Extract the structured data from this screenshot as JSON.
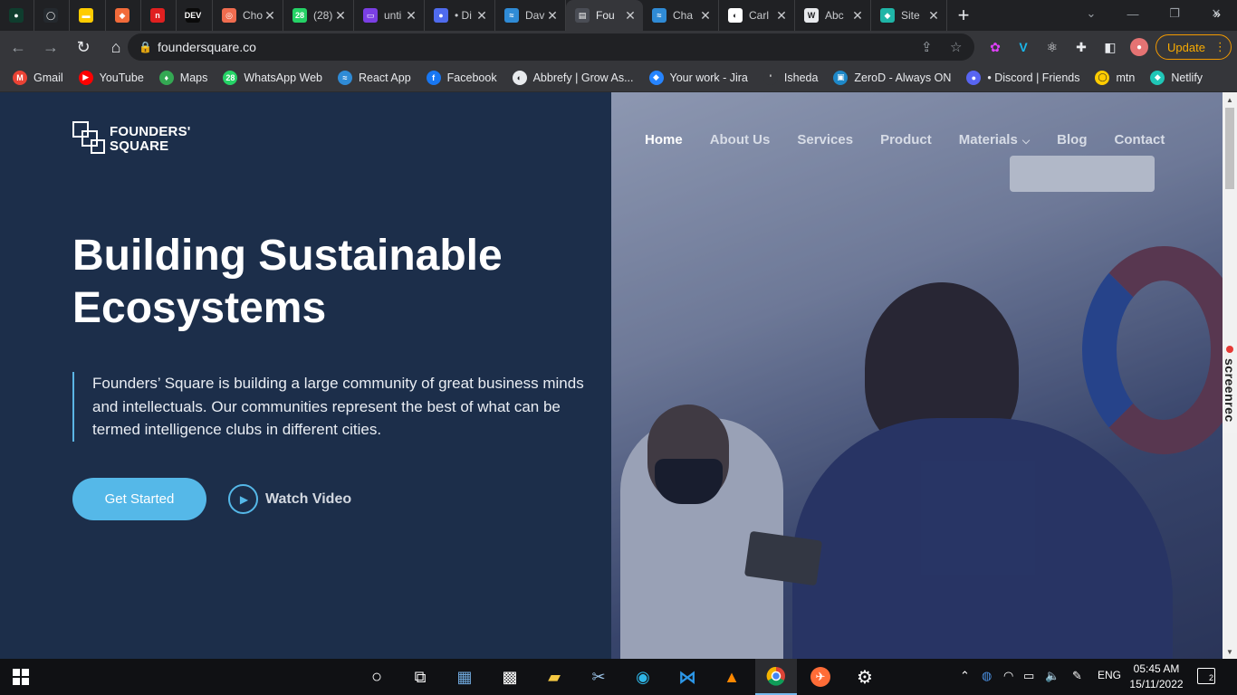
{
  "browser": {
    "tabs": [
      {
        "title": "",
        "fav_color": "#0f3d2e",
        "fav_glyph": "●"
      },
      {
        "title": "",
        "fav_color": "#24292e",
        "fav_glyph": "◯"
      },
      {
        "title": "",
        "fav_color": "#ffcc00",
        "fav_glyph": "▬"
      },
      {
        "title": "",
        "fav_color": "#f26b3a",
        "fav_glyph": "◆"
      },
      {
        "title": "",
        "fav_color": "#e02020",
        "fav_glyph": "n"
      },
      {
        "title": "",
        "fav_color": "#0a0a0a",
        "fav_glyph": "DEV"
      },
      {
        "title": "Cho",
        "fav_color": "#f06c4f",
        "fav_glyph": "◎"
      },
      {
        "title": "(28)",
        "fav_color": "#25d366",
        "fav_glyph": "28"
      },
      {
        "title": "unti",
        "fav_color": "#7b3fe4",
        "fav_glyph": "▭"
      },
      {
        "title": "• Di",
        "fav_color": "#4f6bed",
        "fav_glyph": "●"
      },
      {
        "title": "Dav",
        "fav_color": "#2f8bd6",
        "fav_glyph": "≈"
      },
      {
        "title": "Fou",
        "fav_color": "#4a4d55",
        "fav_glyph": "▤"
      },
      {
        "title": "Cha",
        "fav_color": "#2f8bd6",
        "fav_glyph": "≈"
      },
      {
        "title": "Carl",
        "fav_color": "#ffffff",
        "fav_glyph": "◐"
      },
      {
        "title": "Abc",
        "fav_color": "#e8eaed",
        "fav_glyph": "W"
      },
      {
        "title": "Site",
        "fav_color": "#1fb5a7",
        "fav_glyph": "◆"
      }
    ],
    "url": "foundersquare.co",
    "update_label": "Update",
    "bookmarks": [
      {
        "label": "Gmail",
        "color": "#ea4335",
        "glyph": "M"
      },
      {
        "label": "YouTube",
        "color": "#ff0000",
        "glyph": "▶"
      },
      {
        "label": "Maps",
        "color": "#34a853",
        "glyph": "♦"
      },
      {
        "label": "WhatsApp Web",
        "color": "#25d366",
        "glyph": "28"
      },
      {
        "label": "React App",
        "color": "#2f8bd6",
        "glyph": "≈"
      },
      {
        "label": "Facebook",
        "color": "#1877f2",
        "glyph": "f"
      },
      {
        "label": "Abbrefy | Grow As...",
        "color": "#e8eaed",
        "glyph": "◐"
      },
      {
        "label": "Your work - Jira",
        "color": "#2684ff",
        "glyph": "◆"
      },
      {
        "label": "Isheda",
        "color": "#35363a",
        "glyph": "'"
      },
      {
        "label": "ZeroD - Always ON",
        "color": "#1e88c8",
        "glyph": "▣"
      },
      {
        "label": "• Discord | Friends",
        "color": "#5865f2",
        "glyph": "●"
      },
      {
        "label": "mtn",
        "color": "#ffcc00",
        "glyph": "◯"
      },
      {
        "label": "Netlify",
        "color": "#20c6b7",
        "glyph": "◆"
      }
    ]
  },
  "site": {
    "logo_line1": "FOUNDERS'",
    "logo_line2": "SQUARE",
    "nav": {
      "home": "Home",
      "about": "About Us",
      "services": "Services",
      "product": "Product",
      "materials": "Materials",
      "blog": "Blog",
      "contact": "Contact"
    },
    "headline_line1": "Building Sustainable",
    "headline_line2": "Ecosystems",
    "lead": "Founders’ Square is building a large community of great business minds and intellectuals. Our communities represent the best of what can be termed intelligence clubs in different cities.",
    "cta_primary": "Get Started",
    "cta_secondary": "Watch Video"
  },
  "overlay": {
    "screenrec_label": "screenrec"
  },
  "taskbar": {
    "lang": "ENG",
    "time": "05:45 AM",
    "date": "15/11/2022",
    "notifications": "2"
  }
}
